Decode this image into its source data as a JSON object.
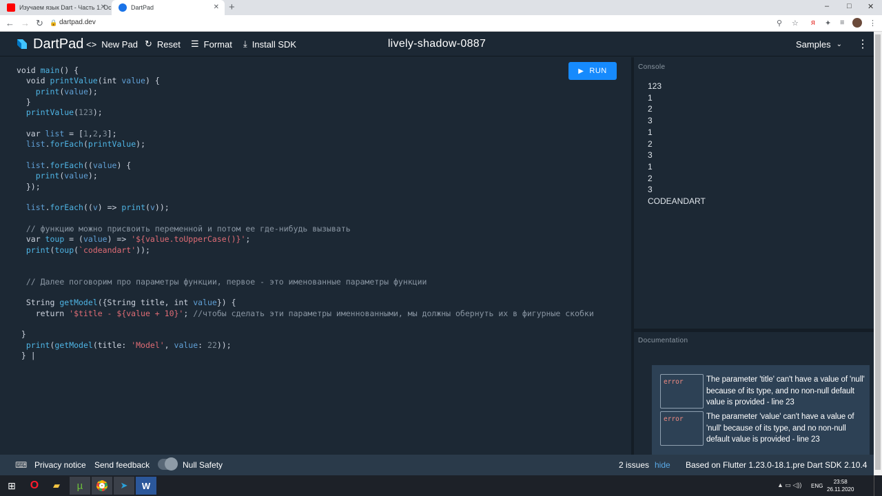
{
  "browser": {
    "tabs": [
      {
        "label": "Изучаем язык Dart - Часть 1. Ос",
        "favicon_color": "#ff0000",
        "active": false
      },
      {
        "label": "DartPad",
        "favicon_color": "#1a73e8",
        "active": true
      }
    ],
    "new_tab": "+",
    "url": "dartpad.dev",
    "window_controls": [
      "–",
      "□",
      "✕"
    ]
  },
  "header": {
    "app_name": "DartPad",
    "new_pad": "New Pad",
    "reset": "Reset",
    "format": "Format",
    "install_sdk": "Install SDK",
    "pad_name": "lively-shadow-0887",
    "samples": "Samples"
  },
  "editor": {
    "run_label": "RUN",
    "code_lines": [
      "void main() {",
      "  void printValue(int value) {",
      "    print(value);",
      "  }",
      "  printValue(123);",
      "",
      "  var list = [1,2,3];",
      "  list.forEach(printValue);",
      "",
      "  list.forEach((value) {",
      "    print(value);",
      "  });",
      "",
      "  list.forEach((v) => print(v));",
      "",
      "  // функцию можно присвоить переменной и потом ее где-нибудь вызывать",
      "  var toup = (value) => '${value.toUpperCase()}';",
      "  print(toup(`codeandart'));",
      "",
      "",
      "  // Далее поговорим про параметры функции, первое - это именованные параметры функции",
      "",
      "  String getModel({String title, int value}) {",
      "    return '$title - ${value + 10}'; //чтобы сделать эти параметры именнованными, мы должны обернуть их в фигурные скобки",
      "",
      " }",
      "  print(getModel(title: 'Model', value: 22));",
      " } |"
    ]
  },
  "console": {
    "label": "Console",
    "lines": [
      "123",
      "1",
      "2",
      "3",
      "1",
      "2",
      "3",
      "1",
      "2",
      "3",
      "CODEANDART"
    ]
  },
  "documentation": {
    "label": "Documentation",
    "issues": [
      {
        "kind": "error",
        "message": "The parameter 'title' can't have a value of 'null' because of its type, and no non-null default value is provided - line 23"
      },
      {
        "kind": "error",
        "message": "The parameter 'value' can't have a value of 'null' because of its type, and no non-null default value is provided - line 23"
      }
    ]
  },
  "footer": {
    "privacy": "Privacy notice",
    "feedback": "Send feedback",
    "null_safety": "Null Safety",
    "issues_count": "2 issues",
    "hide": "hide",
    "sdk_info": "Based on Flutter 1.23.0-18.1.pre Dart SDK 2.10.4"
  },
  "taskbar": {
    "lang": "ENG",
    "time": "23:58",
    "date": "26.11.2020"
  },
  "colors": {
    "accent": "#168afd",
    "background": "#1c2834",
    "link": "#5aa9e6",
    "error": "#f28b82"
  }
}
